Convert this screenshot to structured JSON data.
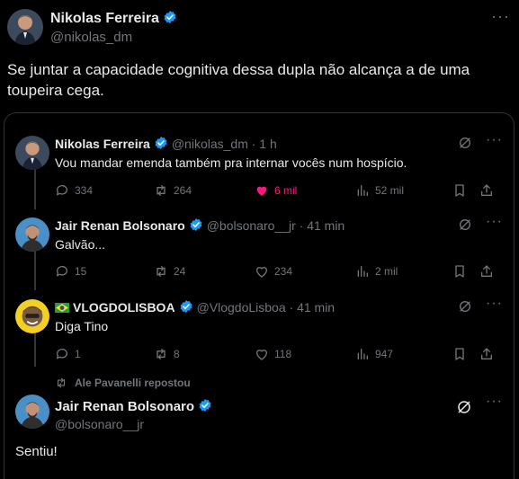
{
  "author": {
    "name": "Nikolas Ferreira",
    "handle": "@nikolas_dm"
  },
  "tweet": {
    "text": "Se juntar a capacidade cognitiva dessa dupla não alcança a de uma toupeira cega."
  },
  "colors": {
    "accent": "#1d9bf0",
    "like": "#f91880",
    "muted": "#71767b",
    "text": "#e7e9ea",
    "border": "#2f3336"
  },
  "thread": [
    {
      "name": "Nikolas Ferreira",
      "handle": "@nikolas_dm · 1 h",
      "text": "Vou mandar emenda também pra internar vocês num hospício.",
      "replies": "334",
      "reposts": "264",
      "likes": "6 mil",
      "views": "52 mil"
    },
    {
      "name": "Jair Renan Bolsonaro",
      "handle": "@bolsonaro__jr · 41 min",
      "text": "Galvão...",
      "replies": "15",
      "reposts": "24",
      "likes": "234",
      "views": "2 mil"
    },
    {
      "name": "VLOGDOLISBOA",
      "handle": "@VlogdoLisboa · 41 min",
      "text": "Diga Tino",
      "replies": "1",
      "reposts": "8",
      "likes": "118",
      "views": "947"
    }
  ],
  "repost_note": "Ale Pavanelli repostou",
  "last_post": {
    "name": "Jair Renan Bolsonaro",
    "handle": "@bolsonaro__jr",
    "text": "Sentiu!"
  },
  "icons": [
    "verified-badge-icon",
    "more-icon",
    "grok-icon",
    "reply-icon",
    "repost-icon",
    "like-icon",
    "views-icon",
    "bookmark-icon",
    "share-icon",
    "brazil-flag-icon"
  ]
}
